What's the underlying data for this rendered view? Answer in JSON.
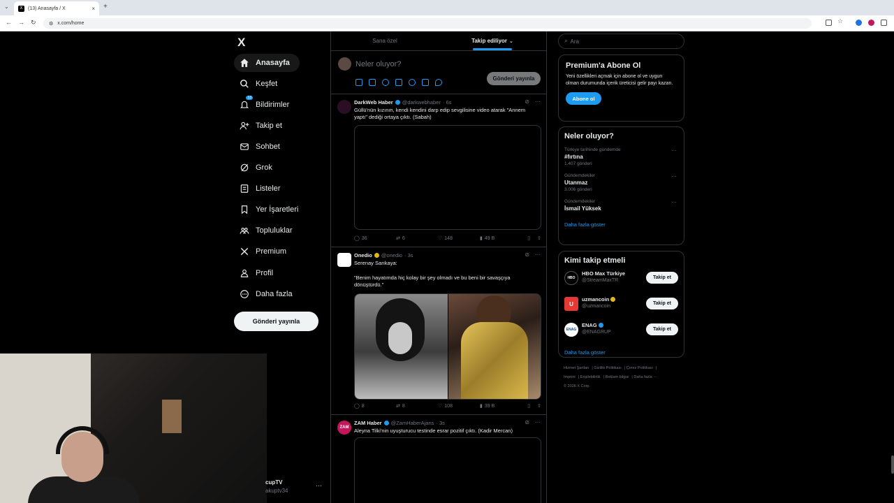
{
  "browser": {
    "tab_title": "(13) Anasayfa / X",
    "url": "x.com/home",
    "new_tab": "+",
    "close": "×"
  },
  "nav": {
    "logo": "X",
    "items": [
      {
        "label": "Anasayfa",
        "icon": "home-icon",
        "active": true
      },
      {
        "label": "Keşfet",
        "icon": "search-icon"
      },
      {
        "label": "Bildirimler",
        "icon": "bell-icon",
        "badge": "13"
      },
      {
        "label": "Takip et",
        "icon": "follow-icon"
      },
      {
        "label": "Sohbet",
        "icon": "mail-icon"
      },
      {
        "label": "Grok",
        "icon": "grok-icon"
      },
      {
        "label": "Listeler",
        "icon": "list-icon"
      },
      {
        "label": "Yer İşaretleri",
        "icon": "bookmark-icon"
      },
      {
        "label": "Topluluklar",
        "icon": "communities-icon"
      },
      {
        "label": "Premium",
        "icon": "x-icon"
      },
      {
        "label": "Profil",
        "icon": "person-icon"
      },
      {
        "label": "Daha fazla",
        "icon": "more-circle-icon"
      }
    ],
    "post_button": "Gönderi yayınla",
    "profile_name": "cupTV",
    "profile_handle": "akuptv34",
    "profile_more": "···"
  },
  "timeline": {
    "tabs": [
      "Sana özel",
      "Takip ediliyor"
    ],
    "active_tab": "Takip ediliyor",
    "compose_placeholder": "Neler oluyor?",
    "compose_post": "Gönderi yayınla",
    "posts": [
      {
        "name": "DarkWeb Haber",
        "handle": "@darkwebhaber",
        "time": "· 6s",
        "text": "Güllü'nün kızının, kendi kendini darp edip sevgilisine video atarak \"Annem yaptı\" dediği ortaya çıktı. (Sabah)",
        "replies": "36",
        "reposts": "6",
        "likes": "148",
        "views": "49 B"
      },
      {
        "name": "Onedio",
        "handle": "@onedio",
        "time": "· 3s",
        "text1": "Serenay Sarıkaya:",
        "text2": "\"Benim hayatımda hiç kolay bir şey olmadı ve bu beni bir savaşçıya dönüştürdü.\"",
        "replies": "8",
        "reposts": "8",
        "likes": "108",
        "views": "39 B"
      },
      {
        "name": "ZAM Haber",
        "handle": "@ZamHaberAjans",
        "time": "· 3s",
        "text": "Aleyna Tilki'nin uyuşturucu testinde esrar pozitif çıktı. (Kadir Mercan)",
        "avatar_text": "ZAM"
      }
    ]
  },
  "sidebar": {
    "search_placeholder": "Ara",
    "premium": {
      "title": "Premium'a Abone Ol",
      "text": "Yeni özellikleri açmak için abone ol ve uygun olman durumunda içerik üreticisi gelir payı kazan.",
      "button": "Abone ol"
    },
    "trends": {
      "title": "Neler oluyor?",
      "items": [
        {
          "context": "Türkiye tarihinde gündemde",
          "name": "#fırtına",
          "count": "1.407 gönderi"
        },
        {
          "context": "Gündemdekiler",
          "name": "Utanmaz",
          "count": "3.006 gönderi"
        },
        {
          "context": "Gündemdekiler",
          "name": "İsmail Yüksek",
          "count": ""
        }
      ],
      "more": "Daha fazla göster"
    },
    "follow": {
      "title": "Kimi takip etmeli",
      "items": [
        {
          "name": "HBO Max Türkiye",
          "handle": "@StreamMaxTR",
          "button": "Takip et",
          "avatar_text": "HBO"
        },
        {
          "name": "uzmancoin",
          "handle": "@uzmancoin",
          "button": "Takip et",
          "avatar_text": "U"
        },
        {
          "name": "ENAG",
          "handle": "@ENAGRUP",
          "button": "Takip et",
          "avatar_text": "ENAG"
        }
      ],
      "more": "Daha fazla göster"
    },
    "footer": [
      "Hizmet Şartları",
      "Gizlilik Politikası",
      "Çerez Politikası",
      "Imprint",
      "Erişilebilirlik",
      "Reklam bilgisi",
      "Daha fazla ···",
      "© 2026 X Corp."
    ]
  },
  "colors": {
    "accent": "#1d9bf0",
    "background": "#000000",
    "border": "#2f3336",
    "gold_badge": "#e2b719"
  }
}
